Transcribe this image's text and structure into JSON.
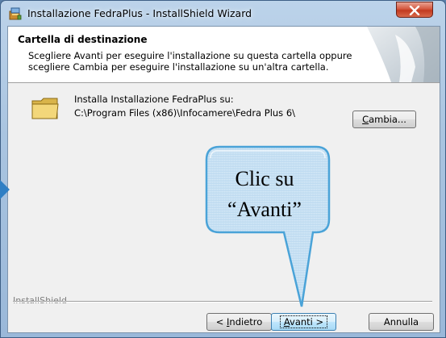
{
  "window": {
    "title": "Installazione FedraPlus - InstallShield Wizard"
  },
  "banner": {
    "title": "Cartella di destinazione",
    "description": "Scegliere Avanti per eseguire l'installazione su questa cartella oppure scegliere Cambia per eseguire l'installazione su un'altra cartella."
  },
  "install": {
    "label": "Installa Installazione FedraPlus su:",
    "path": "C:\\Program Files (x86)\\Infocamere\\Fedra Plus 6\\"
  },
  "buttons": {
    "cambia": {
      "prefix": "",
      "key": "C",
      "rest": "ambia..."
    },
    "indietro": {
      "prefix": "< ",
      "key": "I",
      "rest": "ndietro"
    },
    "avanti": {
      "prefix": "",
      "key": "A",
      "rest": "vanti >"
    },
    "annulla": "Annulla"
  },
  "footer": {
    "brand": "InstallShield"
  },
  "callout": {
    "line1": "Clic su",
    "line2": "“Avanti”",
    "fill_color": "#cbe3f5",
    "border_color": "#4aa3d8"
  },
  "icons": {
    "app": "installer-icon",
    "close": "close-icon",
    "folder": "folder-icon"
  }
}
